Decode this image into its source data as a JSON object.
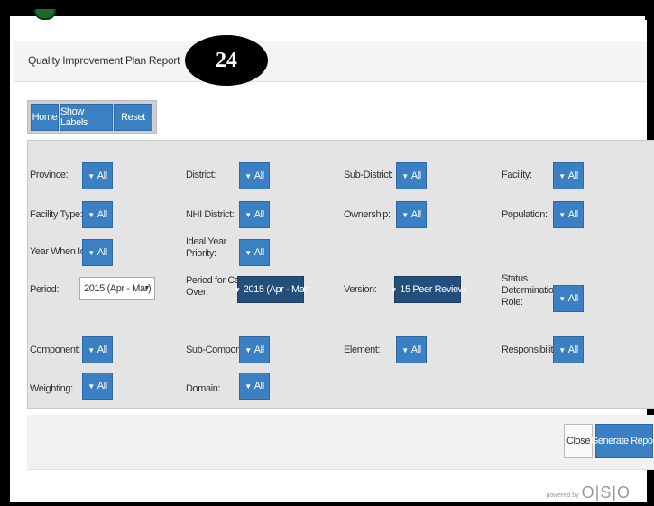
{
  "header": {
    "title": "Quality Improvement Plan Report",
    "badge": "24"
  },
  "toolbar": {
    "home": "Home",
    "show_labels": "Show Labels",
    "reset": "Reset"
  },
  "filter_icon": "funnel-icon",
  "filters": {
    "province": {
      "label": "Province:",
      "value": "All"
    },
    "district": {
      "label": "District:",
      "value": "All"
    },
    "sub_district": {
      "label": "Sub-District:",
      "value": "All"
    },
    "facility": {
      "label": "Facility:",
      "value": "All"
    },
    "facility_type": {
      "label": "Facility Type:",
      "value": "All"
    },
    "nhi_district": {
      "label": "NHI District:",
      "value": "All"
    },
    "ownership": {
      "label": "Ownership:",
      "value": "All"
    },
    "population": {
      "label": "Population:",
      "value": "All"
    },
    "year_when_ideal": {
      "label": "Year When Ideal:",
      "value": "All"
    },
    "ideal_year_priority": {
      "label_line1": "Ideal Year",
      "label_line2": "Priority:",
      "value": "All"
    },
    "period": {
      "label": "Period:",
      "value": "2015 (Apr - Mar)"
    },
    "period_carried_over": {
      "label_line1": "Period for Carried",
      "label_line2": "Over:",
      "value": "2015 (Apr - Mar"
    },
    "version": {
      "label": "Version:",
      "value": "15 Peer Review"
    },
    "status_determination_role": {
      "label_line1": "Status",
      "label_line2": "Determination",
      "label_line3": "Role:",
      "value": "All"
    },
    "component": {
      "label": "Component:",
      "value": "All"
    },
    "sub_component": {
      "label": "Sub-Component:",
      "value": "All"
    },
    "element": {
      "label": "Element:",
      "value": "All"
    },
    "responsibility": {
      "label": "Responsibility:",
      "value": "All"
    },
    "weighting": {
      "label": "Weighting:",
      "value": "All"
    },
    "domain": {
      "label": "Domain:",
      "value": "All"
    }
  },
  "footer": {
    "close": "Close",
    "generate": "Generate Report",
    "powered_by": "powered by",
    "brand": "O|S|O"
  }
}
